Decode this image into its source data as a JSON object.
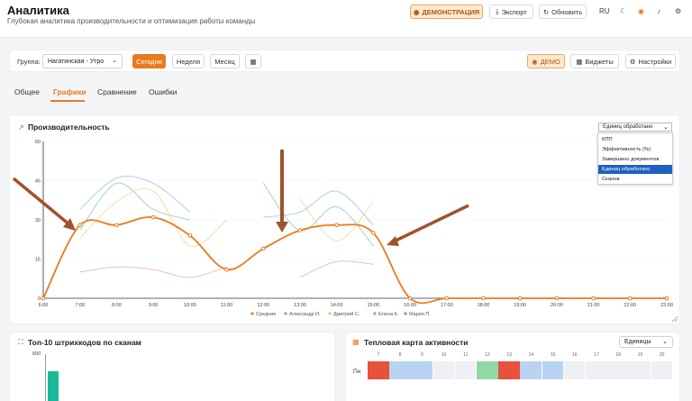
{
  "header": {
    "title": "Аналитика",
    "subtitle": "Глубокая аналитика производительности и оптимизация работы команды",
    "demo_label": "ДЕМОНСТРАЦИЯ",
    "export_label": "Экспорт",
    "refresh_label": "Обновить",
    "lang": "RU"
  },
  "toolbar": {
    "group_label": "Группа:",
    "group_value": "Нагатинская - Утро",
    "period_today": "Сегодня",
    "period_week": "Неделя",
    "period_month": "Месяц",
    "demo_label": "ДЕМО",
    "widgets_label": "Виджеты",
    "settings_label": "Настройки"
  },
  "tabs": [
    "Общее",
    "Графики",
    "Сравнение",
    "Ошибки"
  ],
  "active_tab": "Графики",
  "productivity": {
    "title": "Производительность",
    "metric_selected": "Единиц обработано",
    "metric_options": [
      "КПП",
      "Эффективность (%)",
      "Завершено документов",
      "Единиц обработано",
      "Сканов"
    ],
    "legend": [
      "Средние",
      "Александр И.",
      "Дмитрий С.",
      "Елена К.",
      "Мария П."
    ]
  },
  "barcodes": {
    "title": "Топ-10 штрихкодов по сканам",
    "y_tick": "600"
  },
  "heatmap": {
    "title": "Тепловая карта активности",
    "unit_select": "Единицы",
    "hours": [
      "7",
      "8",
      "9",
      "10",
      "11",
      "12",
      "13",
      "14",
      "15",
      "16",
      "17",
      "18",
      "19",
      "20"
    ],
    "row_label": "Пн",
    "cells": [
      "#e8513a",
      "#b9d3f3",
      "#b9d3f3",
      "#eef0f3",
      "#eef0f3",
      "#8fd9a8",
      "#e8513a",
      "#b9d3f3",
      "#b9d3f3",
      "#eef0f3",
      "#eef0f3",
      "#eef0f3",
      "#eef0f3",
      "#eef0f3"
    ]
  },
  "colors": {
    "accent": "#ea7a1e",
    "series": [
      "#ea7a1e",
      "#6aa6d8",
      "#e8c46a",
      "#d98a8a",
      "#4fb39a"
    ]
  },
  "chart_data": {
    "type": "line",
    "x": [
      "6:00",
      "7:00",
      "8:00",
      "9:00",
      "10:00",
      "11:00",
      "12:00",
      "13:00",
      "14:00",
      "15:00",
      "16:00",
      "17:00",
      "18:00",
      "19:00",
      "20:00",
      "21:00",
      "22:00",
      "23:00"
    ],
    "ylim": [
      0,
      60
    ],
    "yticks": [
      0,
      15,
      30,
      45,
      60
    ],
    "series": [
      {
        "name": "Средние",
        "values": [
          0,
          28,
          28,
          31,
          24,
          11,
          19,
          26,
          28,
          25,
          0,
          0,
          0,
          0,
          0,
          0,
          0,
          0
        ]
      },
      {
        "name": "Александр И.",
        "values": [
          null,
          34,
          46,
          44,
          33,
          null,
          31,
          33,
          41,
          28,
          null,
          null,
          null,
          null,
          null,
          null,
          null,
          null
        ]
      },
      {
        "name": "Дмитрий С.",
        "values": [
          null,
          23,
          37,
          41,
          20,
          30,
          null,
          38,
          22,
          37,
          null,
          null,
          null,
          null,
          null,
          null,
          null,
          null
        ]
      },
      {
        "name": "Елена К.",
        "values": [
          null,
          10,
          12,
          11,
          8,
          12,
          null,
          8,
          14,
          13,
          null,
          null,
          null,
          null,
          null,
          null,
          null,
          null
        ]
      },
      {
        "name": "Мария П.",
        "values": [
          null,
          26,
          44,
          34,
          30,
          null,
          44,
          26,
          35,
          20,
          null,
          null,
          null,
          null,
          null,
          null,
          null,
          null
        ]
      }
    ]
  }
}
